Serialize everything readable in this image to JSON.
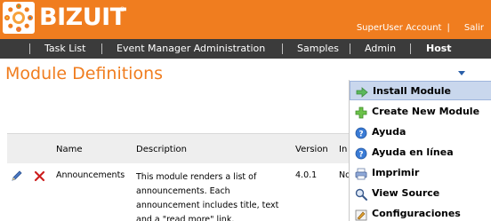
{
  "header": {
    "logo_text": "BIZUIT",
    "logo_mark": "®",
    "account_link": "SuperUser Account",
    "logout_link": "Salir",
    "separator": "|"
  },
  "nav": {
    "items": [
      {
        "label": "Task List"
      },
      {
        "label": "Event Manager Administration"
      },
      {
        "label": "Samples"
      },
      {
        "label": "Admin"
      },
      {
        "label": "Host"
      }
    ]
  },
  "page": {
    "title": "Module Definitions"
  },
  "table": {
    "columns": [
      "Name",
      "Description",
      "Version",
      "In"
    ],
    "rows": [
      {
        "name": "Announcements",
        "description": "This module renders a list of announcements. Each announcement includes title, text and a \"read more\" link.",
        "version": "4.0.1",
        "installed": "No"
      }
    ]
  },
  "menu": {
    "items": [
      {
        "label": "Install Module",
        "icon": "install-arrow-icon",
        "highlighted": true
      },
      {
        "label": "Create New Module",
        "icon": "plus-icon",
        "highlighted": false
      },
      {
        "label": "Ayuda",
        "icon": "help-icon",
        "highlighted": false
      },
      {
        "label": "Ayuda en línea",
        "icon": "online-help-icon",
        "highlighted": false
      },
      {
        "label": "Imprimir",
        "icon": "print-icon",
        "highlighted": false
      },
      {
        "label": "View Source",
        "icon": "magnifier-icon",
        "highlighted": false
      },
      {
        "label": "Configuraciones",
        "icon": "settings-icon",
        "highlighted": false
      }
    ]
  },
  "colors": {
    "brand_orange": "#f07d1f",
    "nav_dark": "#3b3b3b",
    "menu_highlight": "#c9d7ed"
  }
}
